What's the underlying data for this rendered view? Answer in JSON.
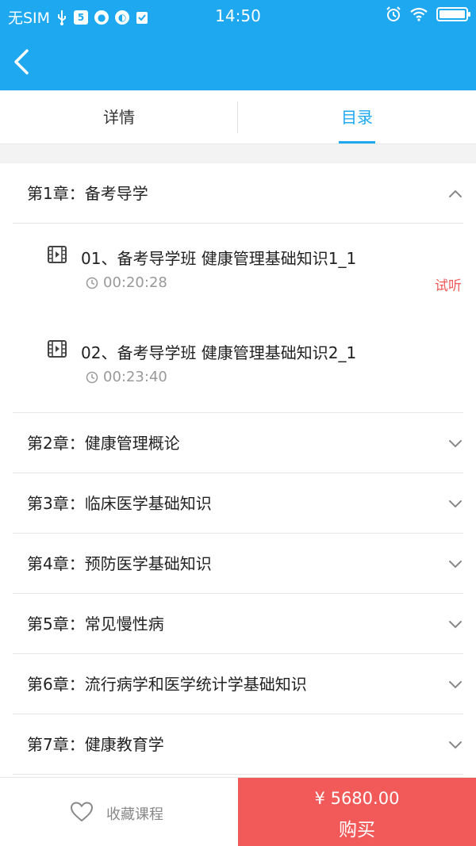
{
  "status_bar": {
    "carrier": "无SIM",
    "time": "14:50",
    "icons": [
      "usb-icon",
      "notification-icon",
      "app-icon",
      "app-icon",
      "checklist-icon",
      "alarm-icon",
      "wifi-icon",
      "battery-icon"
    ]
  },
  "nav": {
    "back_icon": "chevron-left-icon"
  },
  "tabs": [
    {
      "label": "详情",
      "active": false
    },
    {
      "label": "目录",
      "active": true
    }
  ],
  "chapters": [
    {
      "title": "第1章：备考导学",
      "expanded": true,
      "lessons": [
        {
          "title": "01、备考导学班 健康管理基础知识1_1",
          "duration": "00:20:28",
          "badge": "试听"
        },
        {
          "title": "02、备考导学班 健康管理基础知识2_1",
          "duration": "00:23:40",
          "badge": ""
        }
      ]
    },
    {
      "title": "第2章：健康管理概论",
      "expanded": false
    },
    {
      "title": "第3章：临床医学基础知识",
      "expanded": false
    },
    {
      "title": "第4章：预防医学基础知识",
      "expanded": false
    },
    {
      "title": "第5章：常见慢性病",
      "expanded": false
    },
    {
      "title": "第6章：流行病学和医学统计学基础知识",
      "expanded": false
    },
    {
      "title": "第7章：健康教育学",
      "expanded": false
    }
  ],
  "bottom": {
    "favorite_label": "收藏课程",
    "price": "¥  5680.00",
    "buy_label": "购买"
  },
  "colors": {
    "primary": "#1ea8f0",
    "buy": "#f25a5a",
    "trial": "#f25a5a"
  }
}
